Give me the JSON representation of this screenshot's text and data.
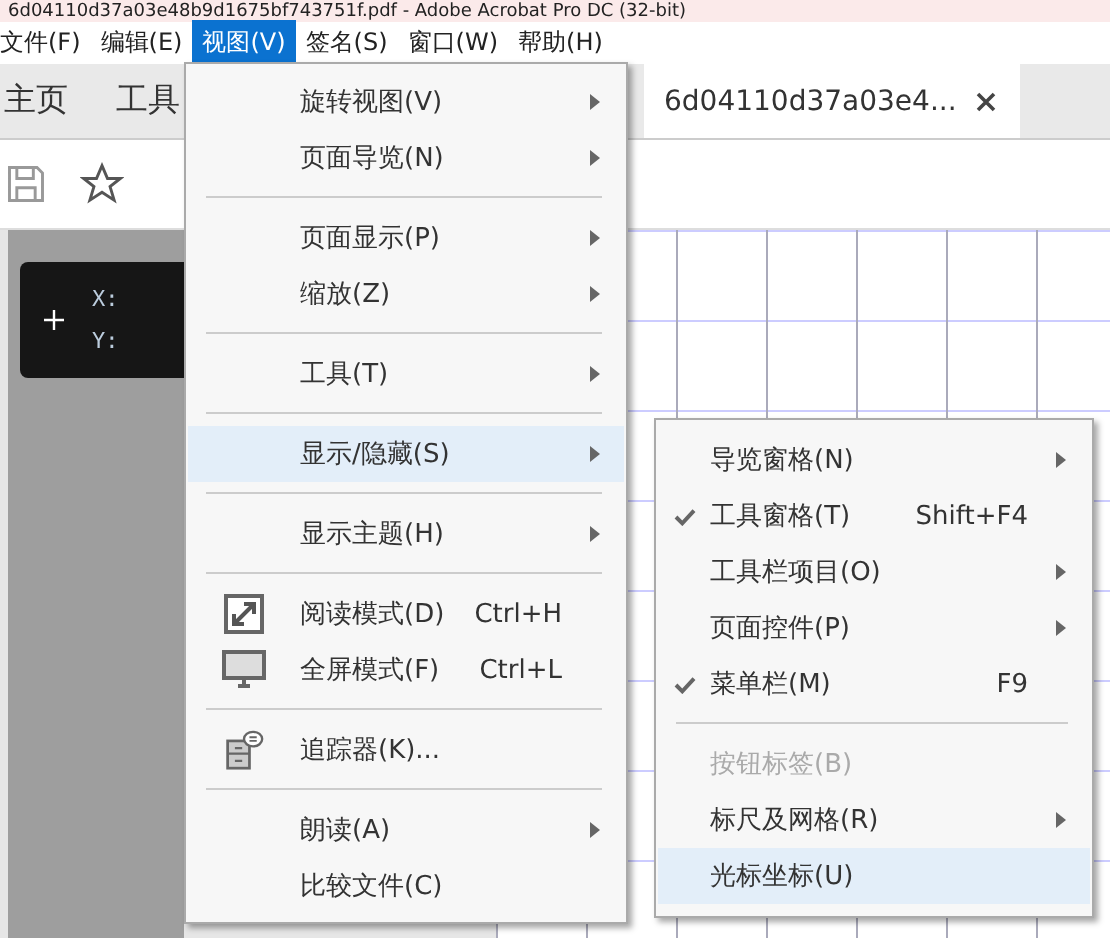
{
  "window": {
    "title": "6d04110d37a03e48b9d1675bf743751f.pdf - Adobe Acrobat Pro DC (32-bit)"
  },
  "menubar": [
    {
      "label": "文件(F)",
      "selected": false
    },
    {
      "label": "编辑(E)",
      "selected": false
    },
    {
      "label": "视图(V)",
      "selected": true
    },
    {
      "label": "签名(S)",
      "selected": false
    },
    {
      "label": "窗口(W)",
      "selected": false
    },
    {
      "label": "帮助(H)",
      "selected": false
    }
  ],
  "tabs": [
    {
      "label": "主页",
      "selected": false
    },
    {
      "label": "工具",
      "selected": false
    },
    {
      "label": "6d04110d37a03e4...",
      "selected": true,
      "closable": true
    }
  ],
  "coordinate_panel": {
    "x_label": "X:",
    "y_label": "Y:"
  },
  "view_menu": [
    {
      "kind": "item",
      "label": "旋转视图(V)",
      "submenu": true,
      "selected": false
    },
    {
      "kind": "item",
      "label": "页面导览(N)",
      "submenu": true,
      "selected": false
    },
    {
      "kind": "separator"
    },
    {
      "kind": "item",
      "label": "页面显示(P)",
      "submenu": true,
      "selected": false
    },
    {
      "kind": "item",
      "label": "缩放(Z)",
      "submenu": true,
      "selected": false
    },
    {
      "kind": "separator"
    },
    {
      "kind": "item",
      "label": "工具(T)",
      "submenu": true,
      "selected": false
    },
    {
      "kind": "separator"
    },
    {
      "kind": "item",
      "label": "显示/隐藏(S)",
      "submenu": true,
      "selected": true
    },
    {
      "kind": "separator"
    },
    {
      "kind": "item",
      "label": "显示主题(H)",
      "submenu": true,
      "selected": false
    },
    {
      "kind": "separator"
    },
    {
      "kind": "iconitem",
      "label": "阅读模式(D)",
      "shortcut": "Ctrl+H",
      "selected": false
    },
    {
      "kind": "iconitem",
      "label": "全屏模式(F)",
      "shortcut": "Ctrl+L",
      "selected": false
    },
    {
      "kind": "separator"
    },
    {
      "kind": "iconitem",
      "label": "追踪器(K)...",
      "selected": false
    },
    {
      "kind": "separator"
    },
    {
      "kind": "item",
      "label": "朗读(A)",
      "submenu": true,
      "selected": false
    },
    {
      "kind": "item",
      "label": "比较文件(C)",
      "selected": false
    }
  ],
  "show_hide_menu": [
    {
      "kind": "item",
      "label": "导览窗格(N)",
      "submenu": true,
      "checked": false,
      "selected": false
    },
    {
      "kind": "item",
      "label": "工具窗格(T)",
      "shortcut": "Shift+F4",
      "checked": true,
      "selected": false
    },
    {
      "kind": "item",
      "label": "工具栏项目(O)",
      "submenu": true,
      "checked": false,
      "selected": false
    },
    {
      "kind": "item",
      "label": "页面控件(P)",
      "submenu": true,
      "checked": false,
      "selected": false
    },
    {
      "kind": "item",
      "label": "菜单栏(M)",
      "shortcut": "F9",
      "checked": true,
      "selected": false
    },
    {
      "kind": "separator"
    },
    {
      "kind": "item",
      "label": "按钮标签(B)",
      "disabled": true,
      "checked": false,
      "selected": false
    },
    {
      "kind": "item",
      "label": "标尺及网格(R)",
      "submenu": true,
      "checked": false,
      "selected": false
    },
    {
      "kind": "item",
      "label": "光标坐标(U)",
      "checked": false,
      "selected": true
    }
  ]
}
